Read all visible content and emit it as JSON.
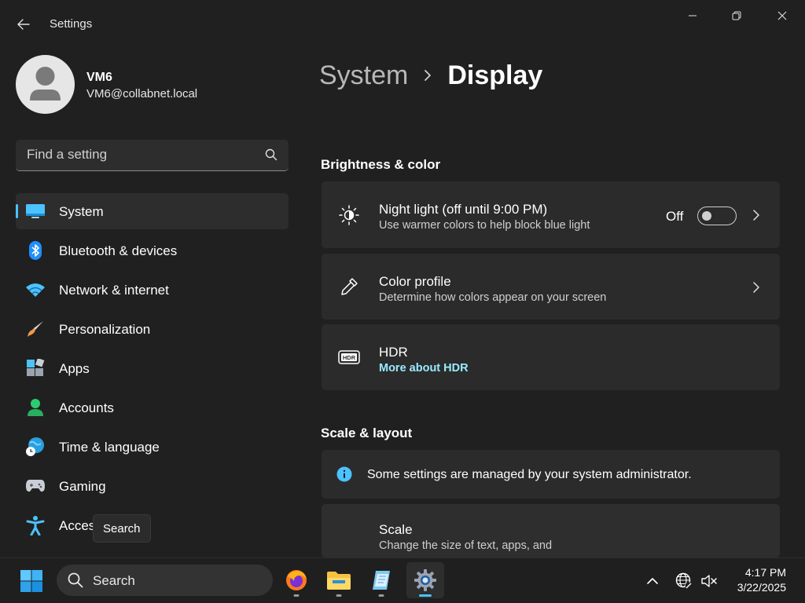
{
  "window": {
    "title": "Settings"
  },
  "profile": {
    "name": "VM6",
    "email": "VM6@collabnet.local"
  },
  "search": {
    "placeholder": "Find a setting"
  },
  "nav": {
    "items": [
      {
        "label": "System",
        "icon": "monitor-icon",
        "active": true
      },
      {
        "label": "Bluetooth & devices",
        "icon": "bluetooth-icon"
      },
      {
        "label": "Network & internet",
        "icon": "wifi-icon"
      },
      {
        "label": "Personalization",
        "icon": "paintbrush-icon"
      },
      {
        "label": "Apps",
        "icon": "apps-icon"
      },
      {
        "label": "Accounts",
        "icon": "person-icon"
      },
      {
        "label": "Time & language",
        "icon": "globe-clock-icon"
      },
      {
        "label": "Gaming",
        "icon": "gamepad-icon"
      },
      {
        "label": "Acces",
        "icon": "accessibility-icon"
      }
    ]
  },
  "tooltip": {
    "text": "Search"
  },
  "breadcrumb": {
    "parent": "System",
    "current": "Display"
  },
  "sections": {
    "brightness": {
      "title": "Brightness & color",
      "night_light": {
        "title": "Night light (off until 9:00 PM)",
        "subtitle": "Use warmer colors to help block blue light",
        "toggle_label": "Off",
        "toggle_on": false
      },
      "color_profile": {
        "title": "Color profile",
        "subtitle": "Determine how colors appear on your screen"
      },
      "hdr": {
        "title": "HDR",
        "link": "More about HDR"
      }
    },
    "scale_layout": {
      "title": "Scale & layout",
      "info": "Some settings are managed by your system administrator.",
      "scale": {
        "title": "Scale",
        "subtitle": "Change the size of text, apps, and"
      }
    }
  },
  "taskbar": {
    "search_label": "Search",
    "apps": [
      "firefox-icon",
      "file-explorer-icon",
      "notepad-icon",
      "settings-gear-icon"
    ],
    "time": "4:17 PM",
    "date": "3/22/2025"
  },
  "colors": {
    "accent": "#4cc2ff",
    "link": "#99ebff",
    "background": "#202020",
    "card": "#2b2b2b"
  }
}
